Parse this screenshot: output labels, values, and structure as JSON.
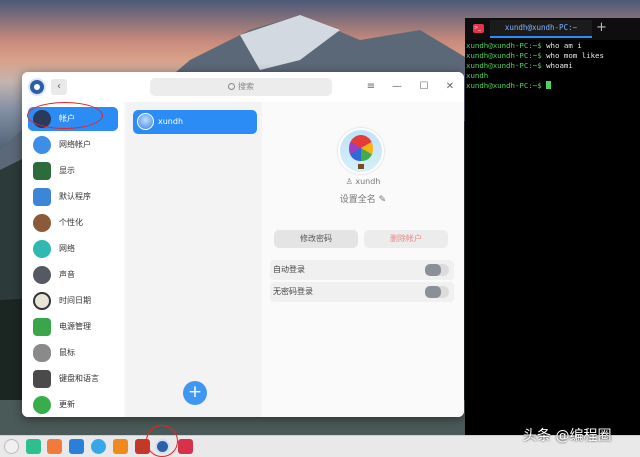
{
  "settings": {
    "search_placeholder": "搜索",
    "window_buttons": {
      "menu": "≡",
      "minimize": "—",
      "maximize": "☐",
      "close": "✕"
    },
    "back_symbol": "‹",
    "sidebar": {
      "items": [
        {
          "label": "帐户",
          "icon": "user-icon",
          "color": "#2b3a5a",
          "active": true
        },
        {
          "label": "网络帐户",
          "icon": "cloud-icon",
          "color": "#3c8ee8"
        },
        {
          "label": "显示",
          "icon": "monitor-icon",
          "color": "#2c6b3a"
        },
        {
          "label": "默认程序",
          "icon": "default-apps-icon",
          "color": "#3c86d8"
        },
        {
          "label": "个性化",
          "icon": "palette-icon",
          "color": "#8a5a3a"
        },
        {
          "label": "网络",
          "icon": "network-icon",
          "color": "#2fb9b0"
        },
        {
          "label": "声音",
          "icon": "speaker-icon",
          "color": "#555a62"
        },
        {
          "label": "时间日期",
          "icon": "clock-icon",
          "color": "#e9e3d8"
        },
        {
          "label": "电源管理",
          "icon": "battery-icon",
          "color": "#3aa54a"
        },
        {
          "label": "鼠标",
          "icon": "mouse-icon",
          "color": "#8a8a8a"
        },
        {
          "label": "键盘和语言",
          "icon": "keyboard-icon",
          "color": "#4a4a4a"
        },
        {
          "label": "更新",
          "icon": "update-icon",
          "color": "#37ad4b"
        }
      ]
    },
    "accounts_list": [
      {
        "name": "xundh"
      }
    ],
    "add_button": "+",
    "detail": {
      "username": "xundh",
      "full_name": "设置全名",
      "change_password": "修改密码",
      "delete_account": "删除帐户",
      "options": [
        {
          "label": "自动登录",
          "enabled": false
        },
        {
          "label": "无密码登录",
          "enabled": false
        }
      ]
    }
  },
  "terminal": {
    "tab_title": "xundh@xundh-PC:~",
    "new_tab": "+",
    "lines": [
      {
        "prompt": "xundh@xundh-PC:~$ ",
        "command": "who am i"
      },
      {
        "prompt": "xundh@xundh-PC:~$ ",
        "command": "who mom likes"
      },
      {
        "prompt": "xundh@xundh-PC:~$ ",
        "command": "whoami"
      },
      {
        "output": "xundh"
      },
      {
        "prompt": "xundh@xundh-PC:~$ ",
        "command": ""
      }
    ]
  },
  "dock": {
    "icons": [
      {
        "name": "launcher-icon",
        "color": "#f0f0f0"
      },
      {
        "name": "file-manager-icon",
        "color": "#2fbf8f"
      },
      {
        "name": "app-store-icon",
        "color": "#f27a3a"
      },
      {
        "name": "upload-icon",
        "color": "#2a7fd8"
      },
      {
        "name": "browser-icon",
        "color": "#38a7e8"
      },
      {
        "name": "package-icon",
        "color": "#f08a1c"
      },
      {
        "name": "calendar-icon",
        "color": "#c0392b"
      },
      {
        "name": "settings-icon",
        "color": "#2d5fa8"
      },
      {
        "name": "terminal-icon",
        "color": "#d8324a"
      }
    ]
  },
  "watermark": "头条 @编程圈"
}
